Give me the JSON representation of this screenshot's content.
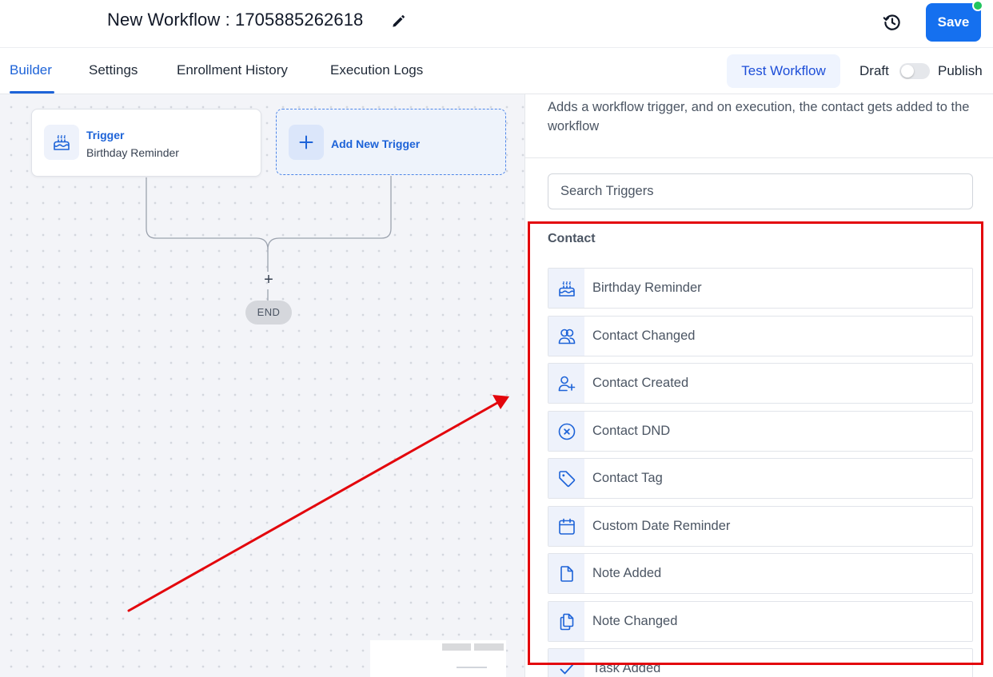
{
  "header": {
    "title": "New Workflow : 1705885262618",
    "save_label": "Save",
    "accent_color": "#1570ef"
  },
  "tabs": [
    {
      "label": "Builder",
      "active": true
    },
    {
      "label": "Settings",
      "active": false
    },
    {
      "label": "Enrollment History",
      "active": false
    },
    {
      "label": "Execution Logs",
      "active": false
    }
  ],
  "toolbar": {
    "test_workflow_label": "Test Workflow",
    "draft_label": "Draft",
    "publish_label": "Publish",
    "publish_toggle_on": false
  },
  "canvas": {
    "trigger_card": {
      "title": "Trigger",
      "subtitle": "Birthday Reminder",
      "icon": "cake-icon"
    },
    "add_trigger_label": "Add New Trigger",
    "plus_symbol": "+",
    "end_label": "END"
  },
  "panel": {
    "description": "Adds a workflow trigger, and on execution, the contact gets added to the workflow",
    "search_placeholder": "Search Triggers",
    "section_title": "Contact",
    "triggers": [
      {
        "label": "Birthday Reminder",
        "icon": "cake-icon"
      },
      {
        "label": "Contact Changed",
        "icon": "users-icon"
      },
      {
        "label": "Contact Created",
        "icon": "user-add-icon"
      },
      {
        "label": "Contact DND",
        "icon": "x-circle-icon"
      },
      {
        "label": "Contact Tag",
        "icon": "tag-icon"
      },
      {
        "label": "Custom Date Reminder",
        "icon": "calendar-icon"
      },
      {
        "label": "Note Added",
        "icon": "file-icon"
      },
      {
        "label": "Note Changed",
        "icon": "files-icon"
      },
      {
        "label": "Task Added",
        "icon": "check-icon"
      }
    ]
  },
  "annotation": {
    "highlight_color": "#e3050c"
  }
}
